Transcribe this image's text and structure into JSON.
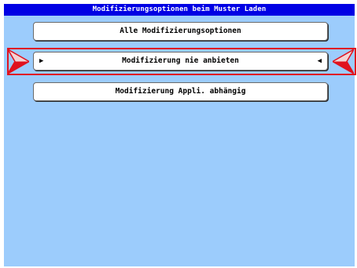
{
  "title": "Modifizierungsoptionen beim Muster Laden",
  "options": [
    {
      "label": "Alle Modifizierungsoptionen",
      "selected": false
    },
    {
      "label": "Modifizierung nie anbieten",
      "selected": true
    },
    {
      "label": "Modifizierung Appli. abhängig",
      "selected": false
    }
  ],
  "selection_markers": {
    "left": "▶",
    "right": "◀"
  },
  "colors": {
    "background": "#9cccfc",
    "title_bar": "#0000e4",
    "title_text": "#ffffff",
    "selection": "#e0121e"
  }
}
